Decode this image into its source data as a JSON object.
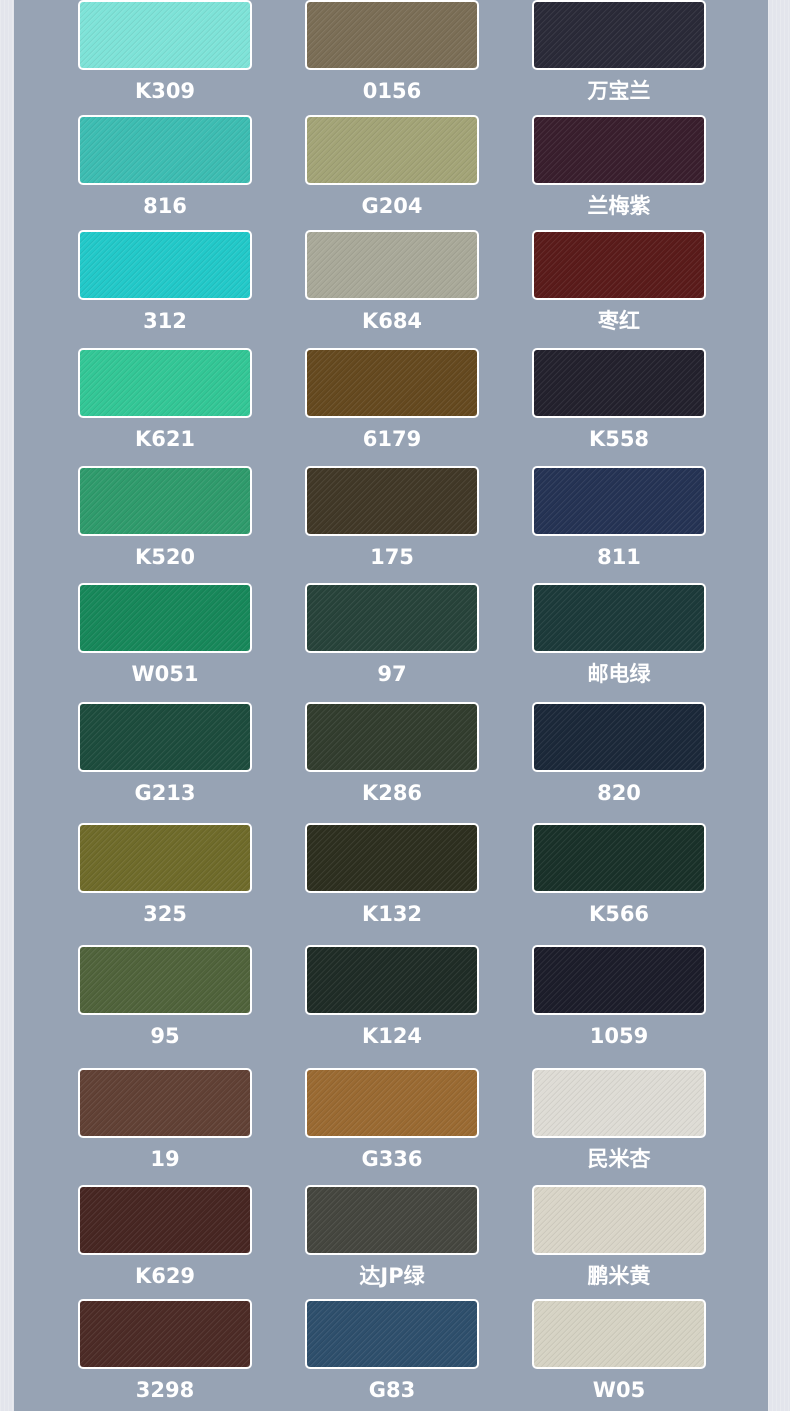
{
  "swatches": [
    {
      "name": "K309",
      "color": "#7ee3d8"
    },
    {
      "name": "0156",
      "color": "#7b6e56"
    },
    {
      "name": "万宝兰",
      "color": "#2a2a38"
    },
    {
      "name": "816",
      "color": "#3dbdb2"
    },
    {
      "name": "G204",
      "color": "#a3a477"
    },
    {
      "name": "兰梅紫",
      "color": "#391e2d"
    },
    {
      "name": "312",
      "color": "#22c9c9"
    },
    {
      "name": "K684",
      "color": "#a9a999"
    },
    {
      "name": "枣红",
      "color": "#5a1b1a"
    },
    {
      "name": "K621",
      "color": "#33c796"
    },
    {
      "name": "6179",
      "color": "#65491f"
    },
    {
      "name": "K558",
      "color": "#23212d"
    },
    {
      "name": "K520",
      "color": "#2f9b6c"
    },
    {
      "name": "175",
      "color": "#413827"
    },
    {
      "name": "811",
      "color": "#253354"
    },
    {
      "name": "W051",
      "color": "#17885a"
    },
    {
      "name": "97",
      "color": "#27433a"
    },
    {
      "name": "邮电绿",
      "color": "#1c3a3a"
    },
    {
      "name": "G213",
      "color": "#1d4c3d"
    },
    {
      "name": "K286",
      "color": "#323d2e"
    },
    {
      "name": "820",
      "color": "#1b2839"
    },
    {
      "name": "325",
      "color": "#6f6b2a"
    },
    {
      "name": "K132",
      "color": "#2d2f1f"
    },
    {
      "name": "K566",
      "color": "#193129"
    },
    {
      "name": "95",
      "color": "#50633b"
    },
    {
      "name": "K124",
      "color": "#1f2c26"
    },
    {
      "name": "1059",
      "color": "#1c1d2a"
    },
    {
      "name": "19",
      "color": "#614135"
    },
    {
      "name": "G336",
      "color": "#9a6a32"
    },
    {
      "name": "民米杏",
      "color": "#dedcd5"
    },
    {
      "name": "K629",
      "color": "#472622"
    },
    {
      "name": "达JP绿",
      "color": "#45463f"
    },
    {
      "name": "鹏米黄",
      "color": "#d9d5c8"
    },
    {
      "name": "3298",
      "color": "#4c2b26"
    },
    {
      "name": "G83",
      "color": "#2e4f6c"
    },
    {
      "name": "W05",
      "color": "#d6d3c4"
    }
  ]
}
